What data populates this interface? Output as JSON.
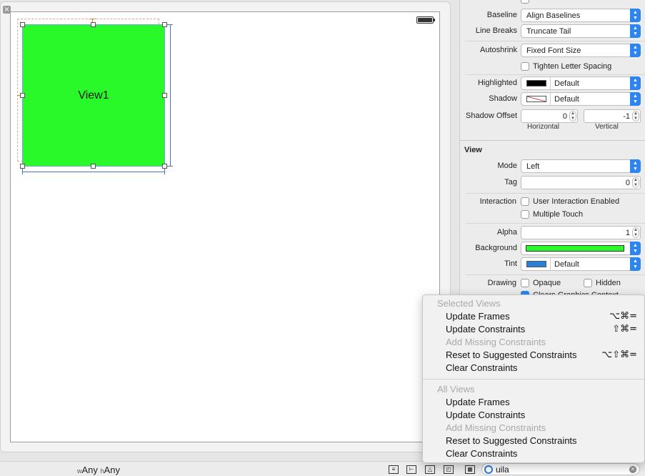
{
  "canvas": {
    "close_glyph": "×",
    "view_label": "View1",
    "view_color": "#29f929"
  },
  "bottom_bar": {
    "width_prefix": "w",
    "width_value": "Any",
    "height_prefix": "h",
    "height_value": "Any",
    "filter_value": "uila"
  },
  "inspector": {
    "baseline": {
      "label": "Baseline",
      "value": "Align Baselines"
    },
    "line_breaks": {
      "label": "Line Breaks",
      "value": "Truncate Tail"
    },
    "autoshrink": {
      "label": "Autoshrink",
      "value": "Fixed Font Size"
    },
    "tighten": {
      "label": "Tighten Letter Spacing",
      "checked": false
    },
    "highlighted": {
      "label": "Highlighted",
      "value": "Default",
      "swatch": "#000000"
    },
    "shadow": {
      "label": "Shadow",
      "value": "Default"
    },
    "shadow_offset": {
      "label": "Shadow Offset",
      "horizontal": "0",
      "vertical": "-1",
      "horizontal_label": "Horizontal",
      "vertical_label": "Vertical"
    },
    "view_section": "View",
    "mode": {
      "label": "Mode",
      "value": "Left"
    },
    "tag": {
      "label": "Tag",
      "value": "0"
    },
    "interaction": {
      "label": "Interaction",
      "user_interaction": "User Interaction Enabled",
      "multiple_touch": "Multiple Touch"
    },
    "alpha": {
      "label": "Alpha",
      "value": "1"
    },
    "background": {
      "label": "Background",
      "color": "#29f929"
    },
    "tint": {
      "label": "Tint",
      "value": "Default",
      "color": "#2a7fd6"
    },
    "drawing": {
      "label": "Drawing",
      "opaque": "Opaque",
      "hidden": "Hidden",
      "clears": "Clears Graphics Context"
    }
  },
  "context_menu": {
    "selected_views": {
      "header": "Selected Views",
      "items": [
        {
          "label": "Update Frames",
          "shortcut": "⌥⌘=",
          "enabled": true
        },
        {
          "label": "Update Constraints",
          "shortcut": "⇧⌘=",
          "enabled": true
        },
        {
          "label": "Add Missing Constraints",
          "shortcut": "",
          "enabled": false
        },
        {
          "label": "Reset to Suggested Constraints",
          "shortcut": "⌥⇧⌘=",
          "enabled": true
        },
        {
          "label": "Clear Constraints",
          "shortcut": "",
          "enabled": true
        }
      ]
    },
    "all_views": {
      "header": "All Views",
      "items": [
        {
          "label": "Update Frames",
          "shortcut": "",
          "enabled": true
        },
        {
          "label": "Update Constraints",
          "shortcut": "",
          "enabled": true
        },
        {
          "label": "Add Missing Constraints",
          "shortcut": "",
          "enabled": false
        },
        {
          "label": "Reset to Suggested Constraints",
          "shortcut": "",
          "enabled": true
        },
        {
          "label": "Clear Constraints",
          "shortcut": "",
          "enabled": true
        }
      ]
    }
  }
}
